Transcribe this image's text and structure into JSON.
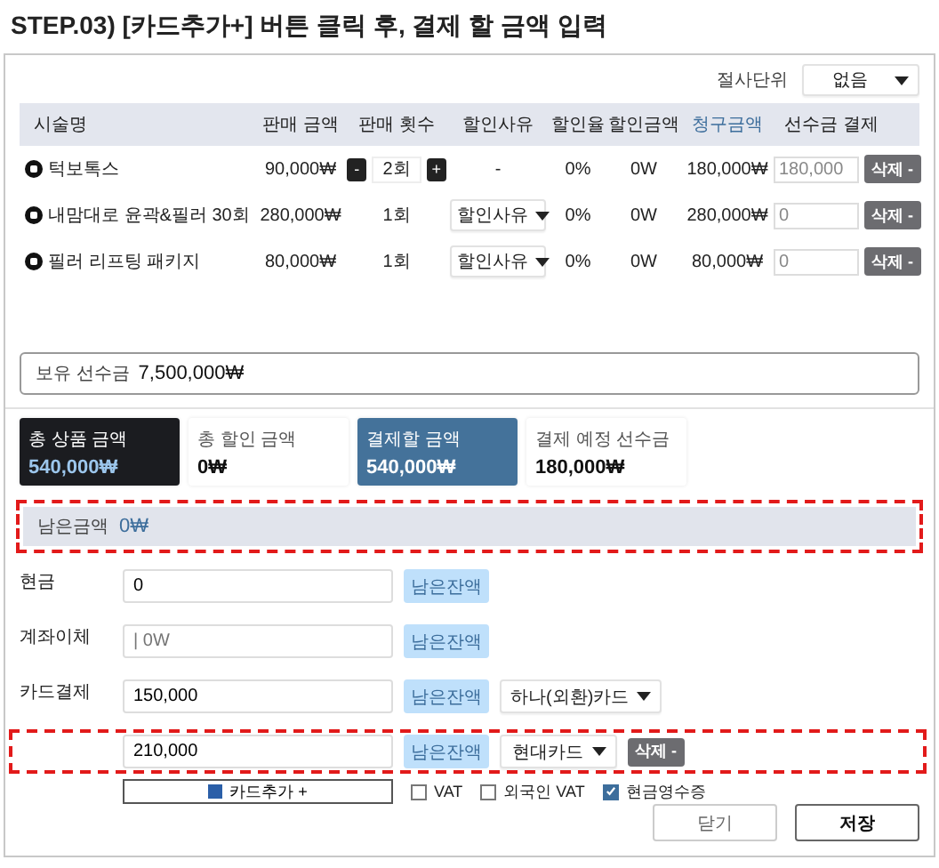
{
  "title": "STEP.03) [카드추가+] 버튼 클릭 후, 결제 할 금액 입력",
  "rounding": {
    "label": "절사단위",
    "value": "없음"
  },
  "table": {
    "columns": [
      {
        "label": "시술명",
        "accent": false
      },
      {
        "label": "판매 금액",
        "accent": false
      },
      {
        "label": "판매 횟수",
        "accent": false
      },
      {
        "label": "할인사유",
        "accent": false
      },
      {
        "label": "할인율",
        "accent": false
      },
      {
        "label": "할인금액",
        "accent": false
      },
      {
        "label": "청구금액",
        "accent": true
      },
      {
        "label": "선수금 결제",
        "accent": false
      }
    ],
    "rows": [
      {
        "name": "턱보톡스",
        "price": "90,000₩",
        "count": {
          "kind": "stepper",
          "minus": "-",
          "value": "2회",
          "plus": "+"
        },
        "reason": {
          "kind": "text",
          "value": "-"
        },
        "rate": "0%",
        "discount": "0W",
        "billed": "180,000₩",
        "prepaid": "180,000",
        "delete": "삭제 -"
      },
      {
        "name": "내맘대로 윤곽&필러 30회",
        "price": "280,000₩",
        "count": {
          "kind": "text",
          "value": "1회"
        },
        "reason": {
          "kind": "select",
          "value": "할인사유"
        },
        "rate": "0%",
        "discount": "0W",
        "billed": "280,000₩",
        "prepaid": "0",
        "delete": "삭제 -"
      },
      {
        "name": "필러 리프팅 패키지",
        "price": "80,000₩",
        "count": {
          "kind": "text",
          "value": "1회"
        },
        "reason": {
          "kind": "select",
          "value": "할인사유"
        },
        "rate": "0%",
        "discount": "0W",
        "billed": "80,000₩",
        "prepaid": "0",
        "delete": "삭제 -"
      }
    ]
  },
  "holdings": {
    "label": "보유 선수금",
    "value": "7,500,000₩"
  },
  "summary": [
    {
      "kind": "dark",
      "label": "총 상품 금액",
      "value": "540,000₩"
    },
    {
      "kind": "plain",
      "label": "총 할인 금액",
      "value": "0₩"
    },
    {
      "kind": "blue",
      "label": "결제할 금액",
      "value": "540,000₩"
    },
    {
      "kind": "plain",
      "label": "결제 예정 선수금",
      "value": "180,000₩"
    }
  ],
  "remaining": {
    "label": "남은금액",
    "value": "0₩",
    "highlighted": true
  },
  "payments": [
    {
      "label": "현금",
      "value": "0",
      "button": "남은잔액",
      "highlighted": false
    },
    {
      "label": "계좌이체",
      "placeholder": "| 0W",
      "button": "남은잔액",
      "highlighted": false
    },
    {
      "label": "카드결제",
      "value": "150,000",
      "button": "남은잔액",
      "card": "하나(외환)카드",
      "highlighted": false
    },
    {
      "value": "210,000",
      "button": "남은잔액",
      "card": "현대카드",
      "delete": "삭제 -",
      "highlighted": true
    }
  ],
  "add_card": "카드추가 +",
  "options": [
    {
      "label": "VAT",
      "checked": false
    },
    {
      "label": "외국인 VAT",
      "checked": false
    },
    {
      "label": "현금영수증",
      "checked": true
    }
  ],
  "footer": [
    {
      "label": "닫기",
      "kind": "secondary"
    },
    {
      "label": "저장",
      "kind": "primary"
    }
  ]
}
